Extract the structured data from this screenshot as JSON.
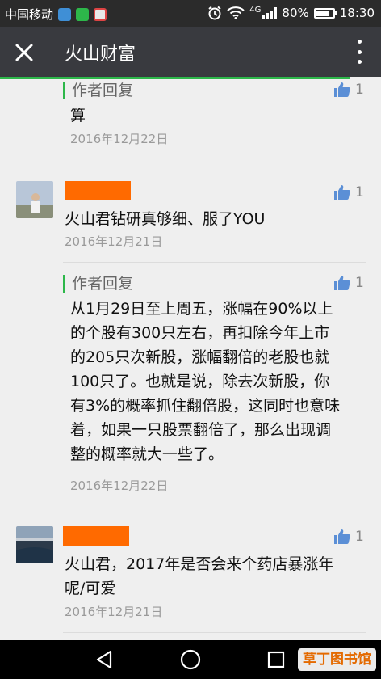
{
  "status_bar": {
    "carrier": "中国移动",
    "network": "4G",
    "battery": "80%",
    "battery_level": 0.8,
    "time": "18:30"
  },
  "header": {
    "title": "火山财富",
    "load_progress": 0.92
  },
  "comments": [
    {
      "reply_label": "作者回复",
      "text": "算",
      "date": "2016年12月22日",
      "likes": "1"
    },
    {
      "text": "火山君钻研真够细、服了YOU",
      "date": "2016年12月21日",
      "likes": "1"
    },
    {
      "reply_label": "作者回复",
      "lines": [
        "从1月29日至上周五，涨幅在90%以上",
        "的个股有300只左右，再扣除今年上市",
        "的205只次新股，涨幅翻倍的老股也就",
        "100只了。也就是说，除去次新股，你",
        "有3%的概率抓住翻倍股，这同时也意味",
        "着，如果一只股票翻倍了，那么出现调",
        "整的概率就大一些了。"
      ],
      "date": "2016年12月22日",
      "likes": "1"
    },
    {
      "lines": [
        "火山君，2017年是否会来个药店暴涨年",
        "呢/可爱"
      ],
      "date": "2016年12月21日",
      "likes": "1"
    }
  ],
  "watermark": "草丁图书馆",
  "colors": {
    "accent_green": "#2db74a",
    "name_redaction": "#ff6a00",
    "header_bg": "#393a3f"
  }
}
